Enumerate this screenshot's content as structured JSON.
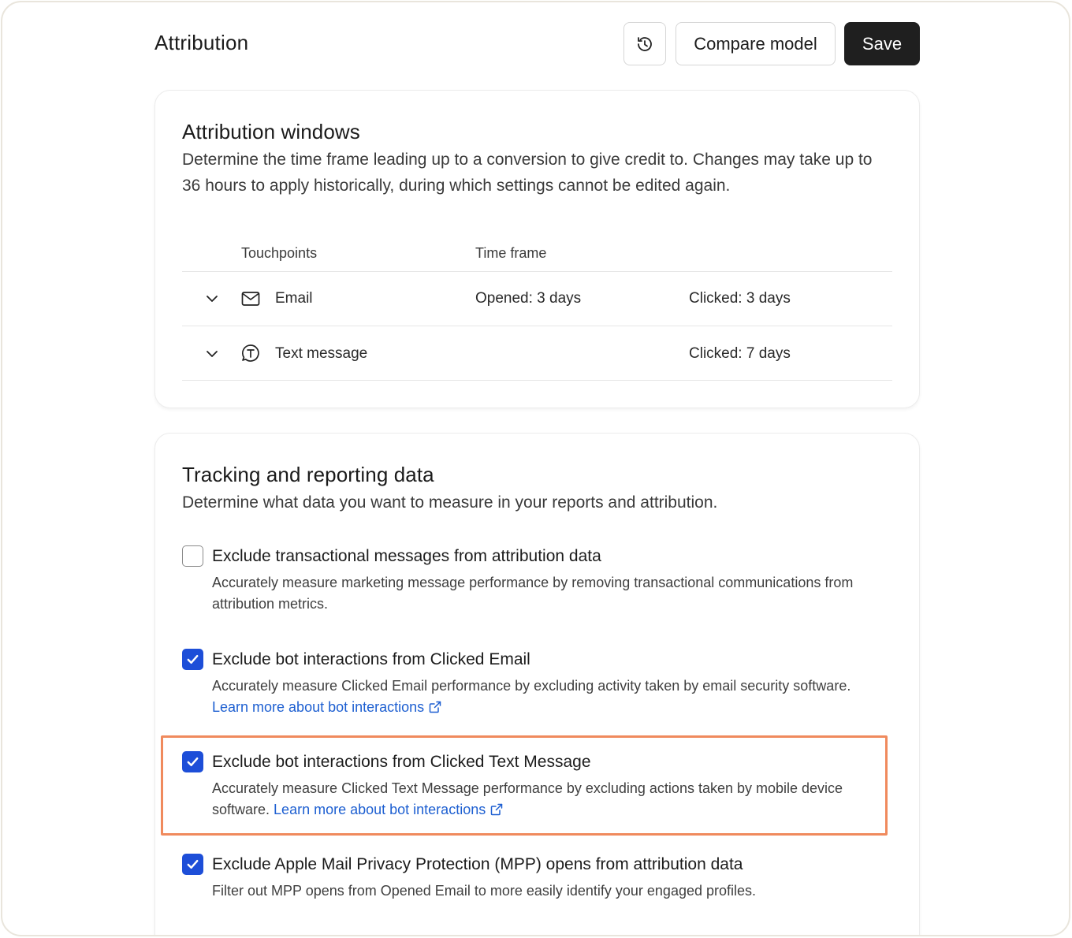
{
  "header": {
    "title": "Attribution",
    "compare_label": "Compare model",
    "save_label": "Save"
  },
  "windows": {
    "title": "Attribution windows",
    "description": "Determine the time frame leading up to a conversion to give credit to. Changes may take up to 36 hours to apply historically, during which settings cannot be edited again.",
    "columns": {
      "touchpoints": "Touchpoints",
      "time_frame": "Time frame"
    },
    "rows": [
      {
        "icon": "mail-icon",
        "name": "Email",
        "opened": "Opened: 3 days",
        "clicked": "Clicked: 3 days"
      },
      {
        "icon": "text-message-icon",
        "name": "Text message",
        "opened": "",
        "clicked": "Clicked: 7 days"
      }
    ]
  },
  "tracking": {
    "title": "Tracking and reporting data",
    "description": "Determine what data you want to measure in your reports and attribution.",
    "options": [
      {
        "checked": false,
        "title": "Exclude transactional messages from attribution data",
        "description": "Accurately measure marketing message performance by removing transactional communications from attribution metrics.",
        "link": ""
      },
      {
        "checked": true,
        "title": "Exclude bot interactions from Clicked Email",
        "description": "Accurately measure Clicked Email performance by excluding activity taken by email security software.",
        "link": "Learn more about bot interactions"
      },
      {
        "checked": true,
        "title": "Exclude bot interactions from Clicked Text Message",
        "description": "Accurately measure Clicked Text Message performance by excluding actions taken by mobile device software.",
        "link": "Learn more about bot interactions"
      },
      {
        "checked": true,
        "title": "Exclude Apple Mail Privacy Protection (MPP) opens from attribution data",
        "description": "Filter out MPP opens from Opened Email to more easily identify your engaged profiles.",
        "link": ""
      }
    ]
  },
  "colors": {
    "checkbox_checked": "#1d4ed8",
    "link": "#1d5fd1",
    "highlight": "#f08a5d",
    "save_bg": "#1f1f1f"
  }
}
